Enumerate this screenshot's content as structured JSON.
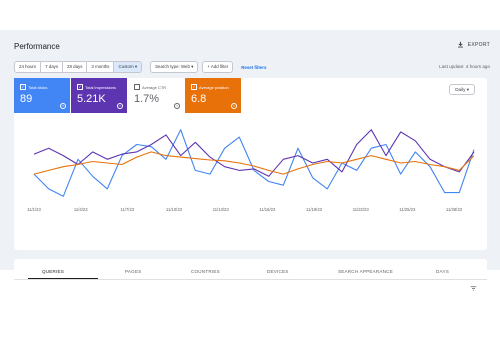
{
  "header": {
    "title": "Performance",
    "export_label": "EXPORT"
  },
  "date_ranges": [
    {
      "label": "24 hours",
      "active": false
    },
    {
      "label": "7 days",
      "active": false
    },
    {
      "label": "28 days",
      "active": false
    },
    {
      "label": "3 months",
      "active": false
    },
    {
      "label": "Custom",
      "active": true
    }
  ],
  "filters": {
    "search_type": "Search type: Web",
    "add_filter": "Add filter",
    "reset": "Reset filters"
  },
  "last_update": "Last update: 4 hours ago",
  "metrics": [
    {
      "label": "Total clicks",
      "value": "89",
      "selected": true,
      "color": "#4285f4"
    },
    {
      "label": "Total impressions",
      "value": "5.21K",
      "selected": true,
      "color": "#5e35b1"
    },
    {
      "label": "Average CTR",
      "value": "1.7%",
      "selected": false,
      "color": "#00897b"
    },
    {
      "label": "Average position",
      "value": "6.8",
      "selected": true,
      "color": "#e8710a"
    }
  ],
  "granularity": "Daily",
  "chart_data": {
    "type": "line",
    "x_tick_labels": [
      "11/1/23",
      "11/4/23",
      "11/7/23",
      "11/10/23",
      "11/13/23",
      "11/16/23",
      "11/19/23",
      "11/22/23",
      "11/25/23",
      "11/28/23"
    ],
    "series": [
      {
        "name": "Total clicks",
        "color": "#4285f4",
        "values": [
          0.35,
          0.15,
          0.05,
          0.55,
          0.32,
          0.15,
          0.6,
          0.75,
          0.72,
          0.55,
          0.95,
          0.4,
          0.35,
          0.7,
          0.85,
          0.4,
          0.25,
          0.2,
          0.7,
          0.3,
          0.15,
          0.5,
          0.4,
          0.7,
          0.75,
          0.35,
          0.65,
          0.45,
          0.1,
          0.1,
          0.68
        ]
      },
      {
        "name": "Total impressions",
        "color": "#5e35b1",
        "values": [
          0.62,
          0.7,
          0.6,
          0.48,
          0.65,
          0.55,
          0.62,
          0.65,
          0.75,
          0.88,
          0.6,
          0.78,
          0.58,
          0.45,
          0.4,
          0.42,
          0.32,
          0.55,
          0.6,
          0.5,
          0.55,
          0.38,
          0.75,
          0.95,
          0.6,
          0.92,
          0.8,
          0.55,
          0.45,
          0.38,
          0.65
        ]
      },
      {
        "name": "Average position",
        "color": "#e8710a",
        "values": [
          0.35,
          0.4,
          0.45,
          0.48,
          0.52,
          0.5,
          0.48,
          0.58,
          0.65,
          0.6,
          0.58,
          0.56,
          0.54,
          0.53,
          0.5,
          0.46,
          0.4,
          0.35,
          0.42,
          0.48,
          0.52,
          0.5,
          0.55,
          0.6,
          0.55,
          0.5,
          0.52,
          0.48,
          0.45,
          0.4,
          0.6
        ]
      }
    ]
  },
  "tabs": [
    "QUERIES",
    "PAGES",
    "COUNTRIES",
    "DEVICES",
    "SEARCH APPEARANCE",
    "DAYS"
  ]
}
